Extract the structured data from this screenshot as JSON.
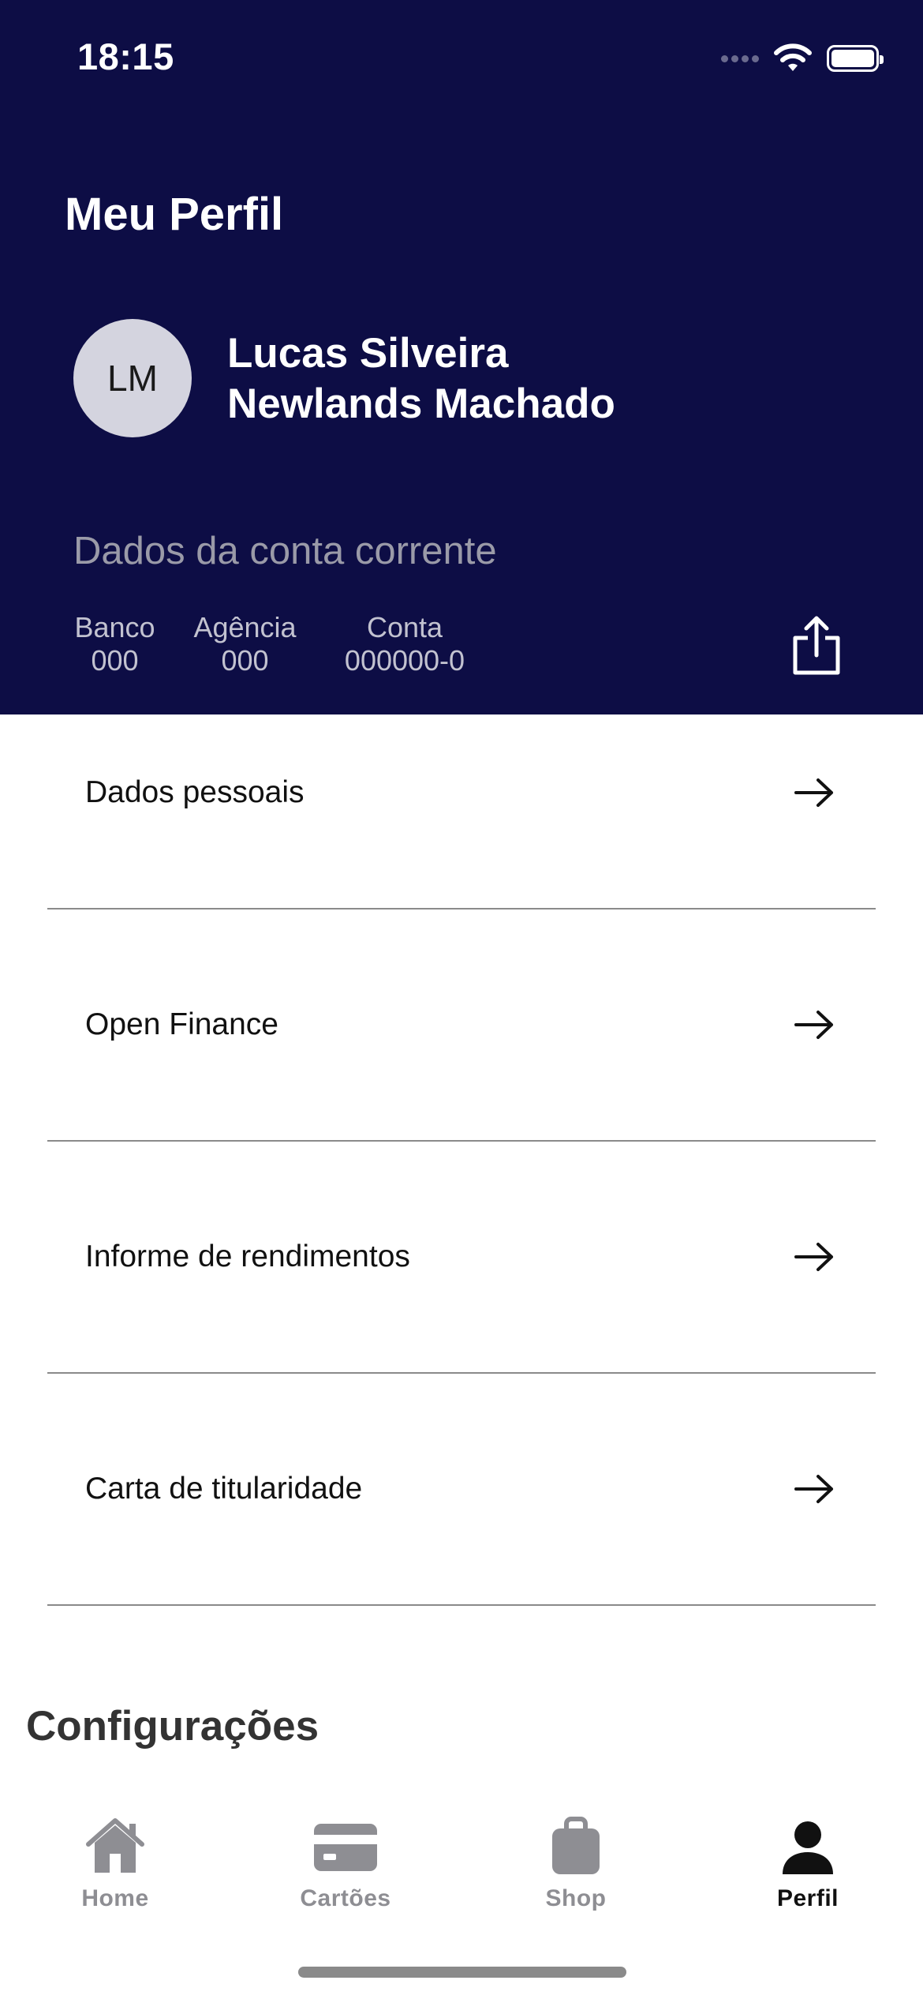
{
  "status_bar": {
    "time": "18:15"
  },
  "header": {
    "title": "Meu Perfil",
    "avatar_initials": "LM",
    "name_line1": "Lucas Silveira",
    "name_line2": "Newlands Machado"
  },
  "account": {
    "section_title": "Dados da conta corrente",
    "bank_label": "Banco",
    "bank_value": "000",
    "agency_label": "Agência",
    "agency_value": "000",
    "account_label": "Conta",
    "account_value": "000000-0"
  },
  "menu": {
    "items": [
      {
        "label": "Dados pessoais"
      },
      {
        "label": "Open Finance"
      },
      {
        "label": "Informe de rendimentos"
      },
      {
        "label": "Carta de titularidade"
      }
    ]
  },
  "settings": {
    "title": "Configurações"
  },
  "tabbar": {
    "tabs": [
      {
        "label": "Home",
        "icon": "home-icon",
        "active": false
      },
      {
        "label": "Cartões",
        "icon": "card-icon",
        "active": false
      },
      {
        "label": "Shop",
        "icon": "bag-icon",
        "active": false
      },
      {
        "label": "Perfil",
        "icon": "person-icon",
        "active": true
      }
    ]
  },
  "colors": {
    "header_bg": "#0d0d45",
    "inactive_tab": "#8e8e93",
    "active_tab": "#111111"
  }
}
